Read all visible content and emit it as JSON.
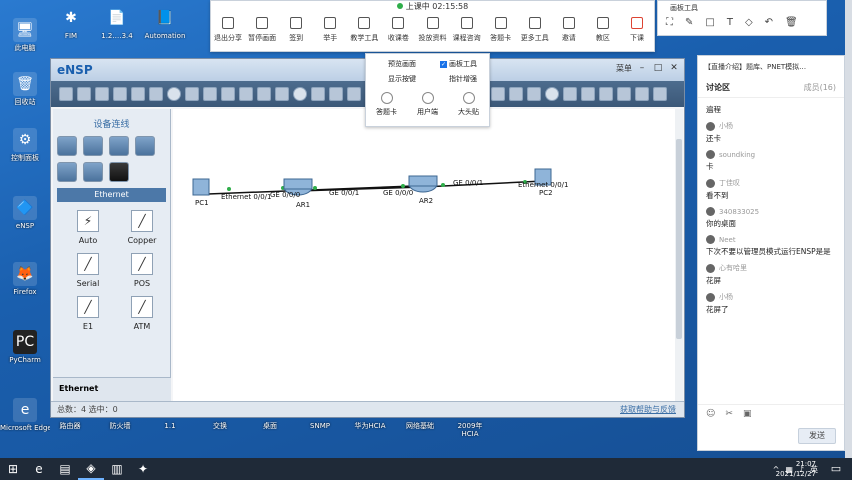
{
  "desktop_icons": [
    {
      "label": "此电脑",
      "name": "this-pc-icon",
      "glyph": "🖥"
    },
    {
      "label": "回收站",
      "name": "recycle-bin-icon",
      "glyph": "🗑"
    },
    {
      "label": "控制面板",
      "name": "control-panel-icon",
      "glyph": "⚙"
    },
    {
      "label": "eNSP",
      "name": "ensp-desktop-icon",
      "glyph": "🔷"
    },
    {
      "label": "Firefox",
      "name": "firefox-icon",
      "glyph": "🦊"
    },
    {
      "label": "PyCharm",
      "name": "pycharm-icon",
      "glyph": "PC"
    },
    {
      "label": "Microsoft Edge",
      "name": "edge-icon",
      "glyph": "e"
    }
  ],
  "desktop_top_icons": [
    {
      "label": "FIM",
      "name": "fim-icon",
      "glyph": "✱"
    },
    {
      "label": "1.2.…3.4",
      "name": "doc-icon-1",
      "glyph": "📄"
    },
    {
      "label": "Automation",
      "name": "automation-icon",
      "glyph": "📘"
    }
  ],
  "bottom_icon_labels": [
    "路由器",
    "防火墙",
    "1.1",
    "交换",
    "桌面",
    "SNMP",
    "华为HCIA",
    "网络基础",
    "2009年HCIA"
  ],
  "ensp": {
    "logo": "eNSP",
    "menu": "菜单",
    "panel_title": "设备连线",
    "category": "Ethernet",
    "cables": [
      {
        "label": "Auto",
        "glyph": "⚡"
      },
      {
        "label": "Copper",
        "glyph": "╱"
      },
      {
        "label": "Serial",
        "glyph": "╱"
      },
      {
        "label": "POS",
        "glyph": "╱"
      },
      {
        "label": "E1",
        "glyph": "╱"
      },
      {
        "label": "ATM",
        "glyph": "╱"
      }
    ],
    "footer": "Ethernet",
    "status_left": "总数：4 选中：0",
    "status_help": "获取帮助与反馈",
    "nodes": [
      {
        "label": "PC1"
      },
      {
        "label": "AR1"
      },
      {
        "label": "AR2"
      },
      {
        "label": "PC2"
      }
    ],
    "ports": [
      "Ethernet 0/0/1",
      "GE 0/0/0",
      "GE 0/0/1",
      "GE 0/0/0",
      "GE 0/0/1",
      "Ethernet 0/0/1"
    ]
  },
  "lesson_bar": {
    "status": "上课中 02:15:58",
    "items": [
      "退出分享",
      "暂停画面",
      "签到",
      "举手",
      "教学工具",
      "收课卷",
      "投放资料",
      "课程咨询",
      "答题卡",
      "更多工具",
      "邀请",
      "教区",
      "下课"
    ]
  },
  "dropdown": {
    "row1_left": "预览画面",
    "row1_right": "画板工具",
    "row2_left": "显示按键",
    "row2_right": "指针增强",
    "icons": [
      "答题卡",
      "用户端",
      "大头贴"
    ]
  },
  "draw_tool": {
    "title": "画板工具"
  },
  "chat": {
    "tabs": "【直播介绍】题库、PNET模拟…",
    "title": "讨论区",
    "members": "成员(16)",
    "messages": [
      {
        "user": "",
        "text": "遍程"
      },
      {
        "user": "小杨",
        "text": "还卡"
      },
      {
        "user": "soundking",
        "text": "卡"
      },
      {
        "user": "丁佳叹",
        "text": "看不到"
      },
      {
        "user": "340833025",
        "text": "你的桌面"
      },
      {
        "user": "Neet",
        "text": "下次不要以管理员模式运行ENSP是是"
      },
      {
        "user": "心有哈里",
        "text": "花屏"
      },
      {
        "user": "小杨",
        "text": "花屏了"
      }
    ],
    "send": "发送"
  },
  "taskbar": {
    "time": "21:07",
    "date": "2021/12/27",
    "ime": "英"
  }
}
